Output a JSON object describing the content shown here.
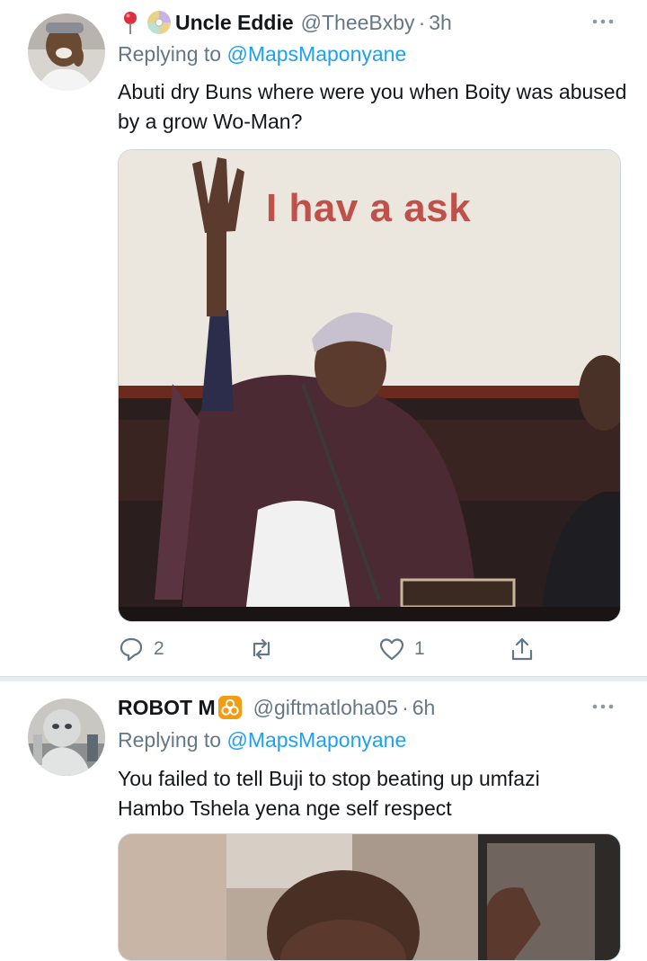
{
  "tweets": [
    {
      "display_name": "Uncle Eddie",
      "handle": "@TheeBxby",
      "time": "3h",
      "reply_prefix": "Replying to",
      "reply_to": "@MapsMaponyane",
      "text": "Abuti dry Buns where were you when Boity was abused by a grow Wo-Man?",
      "media_caption": "I hav a ask",
      "replies": "2",
      "likes": "1"
    },
    {
      "display_name": "ROBOT M",
      "handle": "@giftmatloha05",
      "time": "6h",
      "reply_prefix": "Replying to",
      "reply_to": "@MapsMaponyane",
      "text_line1": "You failed to tell Buji  to stop beating up umfazi",
      "text_line2": "Hambo Tshela yena nge self respect"
    }
  ],
  "separator_dot": "·",
  "icons": {
    "name_prefix_1": [
      "round-pushpin-icon",
      "dvd-icon"
    ],
    "name_suffix_2": "biohazard-icon",
    "more": "more-options-icon",
    "actions": [
      "reply-icon",
      "retweet-icon",
      "like-icon",
      "share-icon"
    ]
  },
  "colors": {
    "link": "#1da1f2",
    "secondary_text": "#657786",
    "primary_text": "#14171a",
    "separator": "#e6ecf0"
  }
}
